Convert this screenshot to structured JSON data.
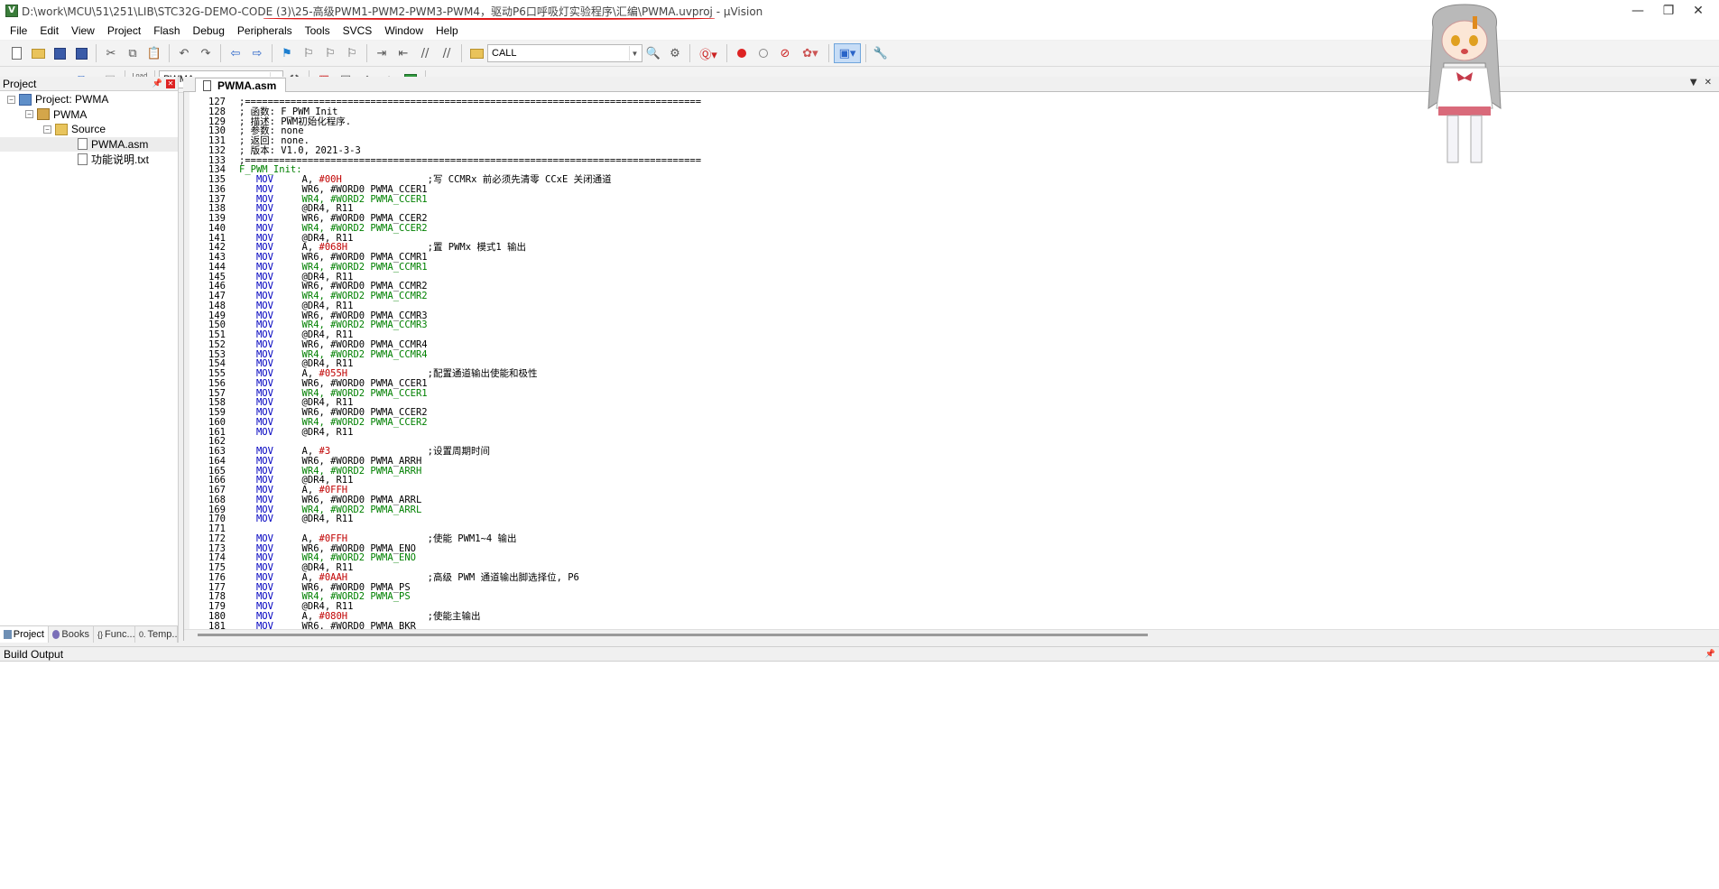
{
  "window": {
    "title_path": "D:\\work\\MCU\\51\\251\\LIB\\STC32G-DEMO-CODE (3)\\25-高级PWM1-PWM2-PWM3-PWM4，驱动P6口呼吸灯实验程序\\汇编\\PWMA.uvproj - µVision",
    "controls": {
      "minimize": "—",
      "restore": "❐",
      "close": "✕"
    }
  },
  "menu": [
    "File",
    "Edit",
    "View",
    "Project",
    "Flash",
    "Debug",
    "Peripherals",
    "Tools",
    "SVCS",
    "Window",
    "Help"
  ],
  "toolbar": {
    "find_combo_value": "CALL",
    "target_combo_value": "PWMA",
    "load_label": "Load"
  },
  "project_panel": {
    "title": "Project",
    "tree": {
      "project": "Project: PWMA",
      "target": "PWMA",
      "group": "Source",
      "files": [
        "PWMA.asm",
        "功能说明.txt"
      ]
    },
    "tabs": [
      "Project",
      "Books",
      "Func...",
      "Temp..."
    ]
  },
  "editor": {
    "tab_label": "PWMA.asm",
    "lines": [
      {
        "n": "127",
        "t": ";================================================================================",
        "k": "cm"
      },
      {
        "n": "128",
        "t": "; 函数: F_PWM_Init",
        "k": "cm"
      },
      {
        "n": "129",
        "t": "; 描述: PWM初始化程序.",
        "k": "cm"
      },
      {
        "n": "130",
        "t": "; 参数: none",
        "k": "cm"
      },
      {
        "n": "131",
        "t": "; 返回: none.",
        "k": "cm"
      },
      {
        "n": "132",
        "t": "; 版本: V1.0, 2021-3-3",
        "k": "cm"
      },
      {
        "n": "133",
        "t": ";================================================================================",
        "k": "cm"
      },
      {
        "n": "134",
        "t": "F_PWM_Init:",
        "k": "lbl"
      },
      {
        "n": "135",
        "op": "MOV",
        "a": "A, ",
        "b": "#00H",
        "c": ";写 CCMRx 前必须先清零 CCxE 关闭通道",
        "k": "ins"
      },
      {
        "n": "136",
        "op": "MOV",
        "a": "WR6, #WORD0 PWMA_CCER1",
        "k": "ins"
      },
      {
        "n": "137",
        "op": "MOV",
        "a": "WR4, #WORD2 PWMA_CCER1",
        "k": "ins"
      },
      {
        "n": "138",
        "op": "MOV",
        "a": "@DR4, R11",
        "k": "ins"
      },
      {
        "n": "139",
        "op": "MOV",
        "a": "WR6, #WORD0 PWMA_CCER2",
        "k": "ins"
      },
      {
        "n": "140",
        "op": "MOV",
        "a": "WR4, #WORD2 PWMA_CCER2",
        "k": "ins"
      },
      {
        "n": "141",
        "op": "MOV",
        "a": "@DR4, R11",
        "k": "ins"
      },
      {
        "n": "142",
        "op": "MOV",
        "a": "A, ",
        "b": "#068H",
        "c": ";置 PWMx 模式1 输出",
        "k": "ins"
      },
      {
        "n": "143",
        "op": "MOV",
        "a": "WR6, #WORD0 PWMA_CCMR1",
        "k": "ins"
      },
      {
        "n": "144",
        "op": "MOV",
        "a": "WR4, #WORD2 PWMA_CCMR1",
        "k": "ins"
      },
      {
        "n": "145",
        "op": "MOV",
        "a": "@DR4, R11",
        "k": "ins"
      },
      {
        "n": "146",
        "op": "MOV",
        "a": "WR6, #WORD0 PWMA_CCMR2",
        "k": "ins"
      },
      {
        "n": "147",
        "op": "MOV",
        "a": "WR4, #WORD2 PWMA_CCMR2",
        "k": "ins"
      },
      {
        "n": "148",
        "op": "MOV",
        "a": "@DR4, R11",
        "k": "ins"
      },
      {
        "n": "149",
        "op": "MOV",
        "a": "WR6, #WORD0 PWMA_CCMR3",
        "k": "ins"
      },
      {
        "n": "150",
        "op": "MOV",
        "a": "WR4, #WORD2 PWMA_CCMR3",
        "k": "ins"
      },
      {
        "n": "151",
        "op": "MOV",
        "a": "@DR4, R11",
        "k": "ins"
      },
      {
        "n": "152",
        "op": "MOV",
        "a": "WR6, #WORD0 PWMA_CCMR4",
        "k": "ins"
      },
      {
        "n": "153",
        "op": "MOV",
        "a": "WR4, #WORD2 PWMA_CCMR4",
        "k": "ins"
      },
      {
        "n": "154",
        "op": "MOV",
        "a": "@DR4, R11",
        "k": "ins"
      },
      {
        "n": "155",
        "op": "MOV",
        "a": "A, ",
        "b": "#055H",
        "c": ";配置通道输出使能和极性",
        "k": "ins"
      },
      {
        "n": "156",
        "op": "MOV",
        "a": "WR6, #WORD0 PWMA_CCER1",
        "k": "ins"
      },
      {
        "n": "157",
        "op": "MOV",
        "a": "WR4, #WORD2 PWMA_CCER1",
        "k": "ins"
      },
      {
        "n": "158",
        "op": "MOV",
        "a": "@DR4, R11",
        "k": "ins"
      },
      {
        "n": "159",
        "op": "MOV",
        "a": "WR6, #WORD0 PWMA_CCER2",
        "k": "ins"
      },
      {
        "n": "160",
        "op": "MOV",
        "a": "WR4, #WORD2 PWMA_CCER2",
        "k": "ins"
      },
      {
        "n": "161",
        "op": "MOV",
        "a": "@DR4, R11",
        "k": "ins"
      },
      {
        "n": "162",
        "t": "",
        "k": "blank"
      },
      {
        "n": "163",
        "op": "MOV",
        "a": "A, ",
        "b": "#3",
        "c": ";设置周期时间",
        "k": "ins"
      },
      {
        "n": "164",
        "op": "MOV",
        "a": "WR6, #WORD0 PWMA_ARRH",
        "k": "ins"
      },
      {
        "n": "165",
        "op": "MOV",
        "a": "WR4, #WORD2 PWMA_ARRH",
        "k": "ins"
      },
      {
        "n": "166",
        "op": "MOV",
        "a": "@DR4, R11",
        "k": "ins"
      },
      {
        "n": "167",
        "op": "MOV",
        "a": "A, ",
        "b": "#0FFH",
        "k": "ins"
      },
      {
        "n": "168",
        "op": "MOV",
        "a": "WR6, #WORD0 PWMA_ARRL",
        "k": "ins"
      },
      {
        "n": "169",
        "op": "MOV",
        "a": "WR4, #WORD2 PWMA_ARRL",
        "k": "ins"
      },
      {
        "n": "170",
        "op": "MOV",
        "a": "@DR4, R11",
        "k": "ins"
      },
      {
        "n": "171",
        "t": "",
        "k": "blank"
      },
      {
        "n": "172",
        "op": "MOV",
        "a": "A, ",
        "b": "#0FFH",
        "c": ";使能 PWM1~4 输出",
        "k": "ins"
      },
      {
        "n": "173",
        "op": "MOV",
        "a": "WR6, #WORD0 PWMA_ENO",
        "k": "ins"
      },
      {
        "n": "174",
        "op": "MOV",
        "a": "WR4, #WORD2 PWMA_ENO",
        "k": "ins"
      },
      {
        "n": "175",
        "op": "MOV",
        "a": "@DR4, R11",
        "k": "ins"
      },
      {
        "n": "176",
        "op": "MOV",
        "a": "A, ",
        "b": "#0AAH",
        "c": ";高级 PWM 通道输出脚选择位, P6",
        "k": "ins"
      },
      {
        "n": "177",
        "op": "MOV",
        "a": "WR6, #WORD0 PWMA_PS",
        "k": "ins"
      },
      {
        "n": "178",
        "op": "MOV",
        "a": "WR4, #WORD2 PWMA_PS",
        "k": "ins"
      },
      {
        "n": "179",
        "op": "MOV",
        "a": "@DR4, R11",
        "k": "ins"
      },
      {
        "n": "180",
        "op": "MOV",
        "a": "A, ",
        "b": "#080H",
        "c": ";使能主输出",
        "k": "ins"
      },
      {
        "n": "181",
        "op": "MOV",
        "a": "WR6, #WORD0 PWMA_BKR",
        "k": "ins"
      }
    ]
  },
  "build_output": {
    "title": "Build Output"
  },
  "colors": {
    "keyword": "#0000c0",
    "label": "#008000",
    "number": "#c00000",
    "annotation": "#e01818"
  }
}
